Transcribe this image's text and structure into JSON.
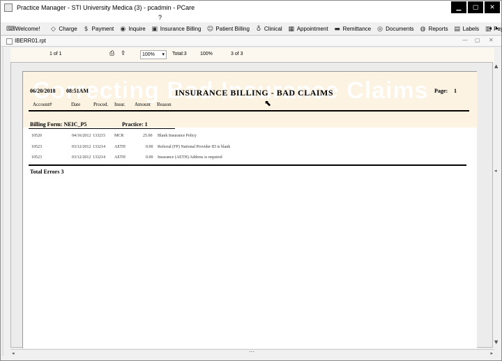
{
  "window": {
    "title": "Practice Manager - STI University Medica  (3) - pcadmin - PCare",
    "controls": [
      "minimize",
      "maximize",
      "close"
    ]
  },
  "menubar": {
    "help": "?"
  },
  "toolbar": {
    "buttons": [
      {
        "label": "Welcome!",
        "icon": "keyboard-icon"
      },
      {
        "label": "Charge",
        "icon": "tag-icon"
      },
      {
        "label": "Payment",
        "icon": "dollar-icon"
      },
      {
        "label": "Inquire",
        "icon": "magnifier-icon"
      },
      {
        "label": "Insurance Billing",
        "icon": "insurance-icon"
      },
      {
        "label": "Patient Billing",
        "icon": "patient-icon"
      },
      {
        "label": "Clinical",
        "icon": "clinical-icon"
      },
      {
        "label": "Appointment",
        "icon": "calendar-icon"
      },
      {
        "label": "Remittance",
        "icon": "remittance-icon"
      },
      {
        "label": "Documents",
        "icon": "documents-icon"
      },
      {
        "label": "Reports",
        "icon": "reports-icon"
      },
      {
        "label": "Labels",
        "icon": "labels-icon"
      },
      {
        "label": "Payer",
        "icon": "payer-icon"
      }
    ],
    "nav_left": "◂",
    "nav_right": "▸"
  },
  "document_tab": {
    "filename": "IBERR01.rpt",
    "controls": [
      "—",
      "▢",
      "✕"
    ]
  },
  "viewer_toolbar": {
    "page_of": "1 of 1",
    "zoom": "100%",
    "total": "Total:3",
    "percent": "100%",
    "count": "3 of 3"
  },
  "banner": {
    "text": "Correcting Bad Insurance Claims"
  },
  "report": {
    "date": "06/20/2018",
    "time": "08:51AM",
    "title": "INSURANCE BILLING - BAD CLAIMS",
    "page_label": "Page:",
    "page_num": "1",
    "columns": [
      "Account#",
      "Date",
      "Proced.",
      "Insur.",
      "Amount",
      "Reason"
    ],
    "billing_form_label": "Billing Form: NEIC_P5",
    "practice_label": "Practice: 1",
    "rows": [
      {
        "account": "10520",
        "date": "04/16/2012",
        "proc": "133215",
        "insur": "MCR",
        "amount": "25.00",
        "reason": "Blank Insurance Policy"
      },
      {
        "account": "10523",
        "date": "03/12/2012",
        "proc": "133214",
        "insur": "AETH",
        "amount": "0.00",
        "reason": "Referral (FP) National Provider ID is blank"
      },
      {
        "account": "10523",
        "date": "03/12/2012",
        "proc": "133214",
        "insur": "AETH",
        "amount": "0.00",
        "reason": "Insurance (AETH) Address is required"
      }
    ],
    "total_errors": "Total Errors  3"
  }
}
